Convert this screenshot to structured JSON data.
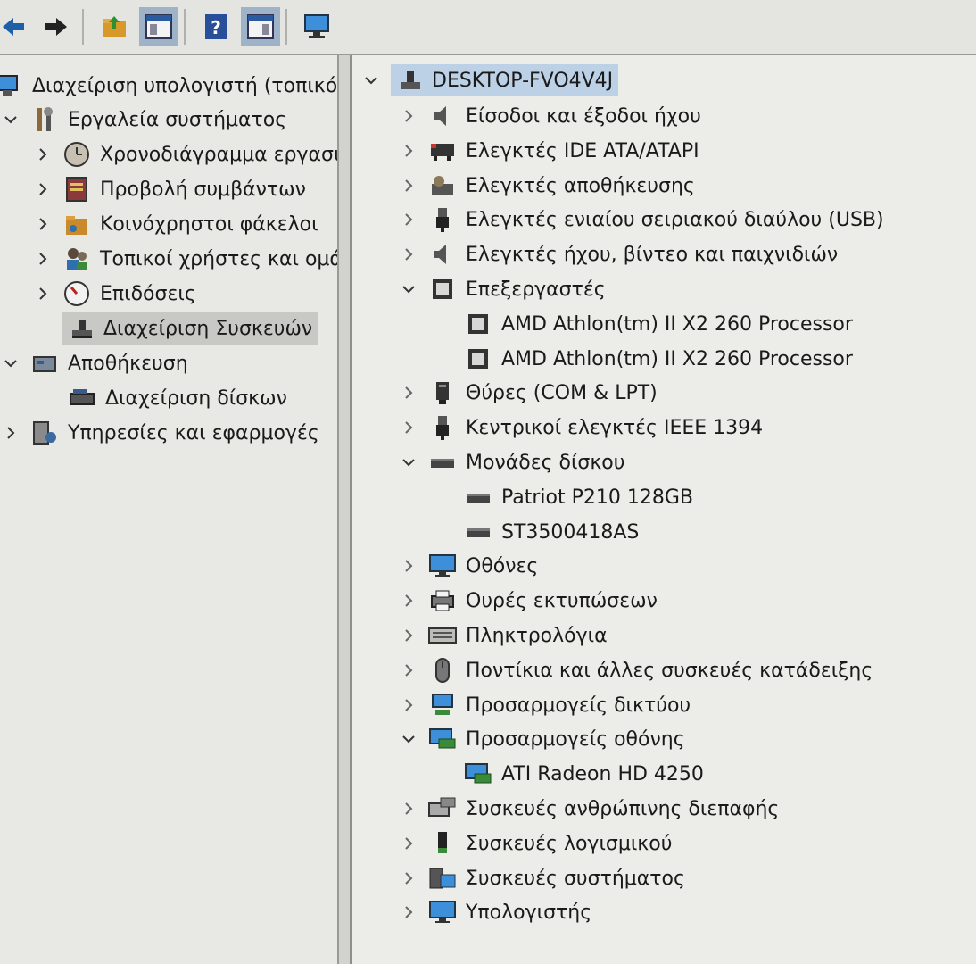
{
  "left_tree": {
    "items": [
      {
        "label": "Διαχείριση υπολογιστή (τοπικό)",
        "icon": "computer-management-icon"
      },
      {
        "label": "Εργαλεία συστήματος",
        "icon": "system-tools-icon"
      },
      {
        "label": "Χρονοδιάγραμμα εργασιών",
        "icon": "clock-icon"
      },
      {
        "label": "Προβολή συμβάντων",
        "icon": "event-viewer-icon"
      },
      {
        "label": "Κοινόχρηστοι φάκελοι",
        "icon": "shared-folder-icon"
      },
      {
        "label": "Τοπικοί χρήστες και ομάδες",
        "icon": "users-icon"
      },
      {
        "label": "Επιδόσεις",
        "icon": "performance-icon"
      },
      {
        "label": "Διαχείριση Συσκευών",
        "icon": "device-manager-icon"
      },
      {
        "label": "Αποθήκευση",
        "icon": "storage-icon"
      },
      {
        "label": "Διαχείριση δίσκων",
        "icon": "disk-management-icon"
      },
      {
        "label": "Υπηρεσίες και εφαρμογές",
        "icon": "services-icon"
      }
    ]
  },
  "device_tree": {
    "root": {
      "label": "DESKTOP-FVO4V4J",
      "icon": "computer-icon"
    },
    "items": [
      {
        "label": "Είσοδοι και έξοδοι ήχου",
        "icon": "speaker-icon",
        "state": "collapsed"
      },
      {
        "label": "Ελεγκτές IDE ATA/ATAPI",
        "icon": "ide-controller-icon",
        "state": "collapsed"
      },
      {
        "label": "Ελεγκτές αποθήκευσης",
        "icon": "storage-controller-icon",
        "state": "collapsed"
      },
      {
        "label": "Ελεγκτές ενιαίου σειριακού διαύλου (USB)",
        "icon": "usb-icon",
        "state": "collapsed"
      },
      {
        "label": "Ελεγκτές ήχου, βίντεο και παιχνιδιών",
        "icon": "speaker-icon",
        "state": "collapsed"
      },
      {
        "label": "Επεξεργαστές",
        "icon": "processor-icon",
        "state": "expanded"
      },
      {
        "label": "AMD Athlon(tm) II X2 260 Processor",
        "icon": "processor-icon",
        "state": "child"
      },
      {
        "label": "AMD Athlon(tm) II X2 260 Processor",
        "icon": "processor-icon",
        "state": "child"
      },
      {
        "label": "Θύρες (COM & LPT)",
        "icon": "port-icon",
        "state": "collapsed"
      },
      {
        "label": "Κεντρικοί ελεγκτές IEEE 1394",
        "icon": "usb-icon",
        "state": "collapsed"
      },
      {
        "label": "Μονάδες δίσκου",
        "icon": "disk-drive-icon",
        "state": "expanded"
      },
      {
        "label": "Patriot P210 128GB",
        "icon": "disk-drive-icon",
        "state": "child"
      },
      {
        "label": "ST3500418AS",
        "icon": "disk-drive-icon",
        "state": "child"
      },
      {
        "label": "Οθόνες",
        "icon": "monitor-icon",
        "state": "collapsed"
      },
      {
        "label": "Ουρές εκτυπώσεων",
        "icon": "printer-icon",
        "state": "collapsed"
      },
      {
        "label": "Πληκτρολόγια",
        "icon": "keyboard-icon",
        "state": "collapsed"
      },
      {
        "label": "Ποντίκια και άλλες συσκευές κατάδειξης",
        "icon": "mouse-icon",
        "state": "collapsed"
      },
      {
        "label": "Προσαρμογείς δικτύου",
        "icon": "network-adapter-icon",
        "state": "collapsed"
      },
      {
        "label": "Προσαρμογείς οθόνης",
        "icon": "display-adapter-icon",
        "state": "expanded"
      },
      {
        "label": "ATI Radeon HD 4250",
        "icon": "display-adapter-icon",
        "state": "child"
      },
      {
        "label": "Συσκευές ανθρώπινης διεπαφής",
        "icon": "hid-icon",
        "state": "collapsed"
      },
      {
        "label": "Συσκευές λογισμικού",
        "icon": "software-device-icon",
        "state": "collapsed"
      },
      {
        "label": "Συσκευές συστήματος",
        "icon": "system-device-icon",
        "state": "collapsed"
      },
      {
        "label": "Υπολογιστής",
        "icon": "monitor-icon",
        "state": "collapsed"
      }
    ]
  },
  "colors": {
    "accent": "#3c8fd8",
    "selection": "#bcd0e6"
  }
}
